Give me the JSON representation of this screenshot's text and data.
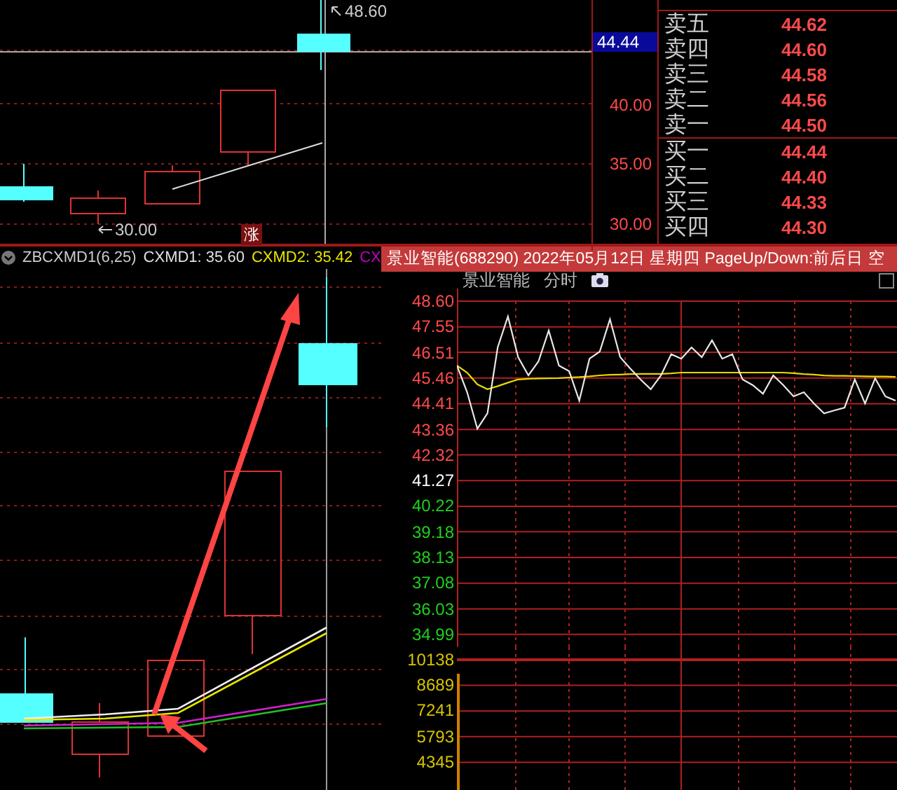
{
  "kline_panel": {
    "high_label": "48.60",
    "low_label": "30.00",
    "badge": "涨",
    "current_price": "44.44",
    "price_labels": [
      {
        "text": "40.00"
      },
      {
        "text": "35.00"
      },
      {
        "text": "30.00"
      }
    ]
  },
  "order_book": {
    "asks": [
      {
        "label": "卖五",
        "price": "44.62"
      },
      {
        "label": "卖四",
        "price": "44.60"
      },
      {
        "label": "卖三",
        "price": "44.58"
      },
      {
        "label": "卖二",
        "price": "44.56"
      },
      {
        "label": "卖一",
        "price": "44.50"
      }
    ],
    "bids": [
      {
        "label": "买一",
        "price": "44.44"
      },
      {
        "label": "买二",
        "price": "44.40"
      },
      {
        "label": "买三",
        "price": "44.33"
      },
      {
        "label": "买四",
        "price": "44.30"
      }
    ]
  },
  "indicator_panel": {
    "name": "ZBCXMD1(6,25)",
    "values": [
      {
        "label": "CXMD1: 35.60",
        "color": "#e0e0e0"
      },
      {
        "label": "CXMD2: 35.42",
        "color": "#e6e600"
      },
      {
        "label": "CX",
        "color": "#c000c0"
      }
    ]
  },
  "intraday_popup": {
    "title": "景业智能(688290) 2022年05月12日 星期四 PageUp/Down:前后日 空",
    "stock": "景业智能",
    "mode": "分时",
    "checkbox": {
      "checked": false
    },
    "volume_labels": [
      {
        "text": "10138",
        "kind": "volume"
      },
      {
        "text": "8689",
        "kind": "volume"
      },
      {
        "text": "7241",
        "kind": "volume"
      },
      {
        "text": "5793",
        "kind": "volume"
      },
      {
        "text": "4345",
        "kind": "volume"
      }
    ],
    "chart_data": {
      "type": "line",
      "ylim": [
        34.99,
        48.6
      ],
      "grid": true,
      "yticks": [
        {
          "value": 48.6,
          "label": "48.60"
        },
        {
          "value": 47.55,
          "label": "47.55"
        },
        {
          "value": 46.51,
          "label": "46.51"
        },
        {
          "value": 45.46,
          "label": "45.46"
        },
        {
          "value": 44.41,
          "label": "44.41"
        },
        {
          "value": 43.36,
          "label": "43.36"
        },
        {
          "value": 42.32,
          "label": "42.32"
        },
        {
          "value": 41.27,
          "label": "41.27"
        },
        {
          "value": 40.22,
          "label": "40.22"
        },
        {
          "value": 39.18,
          "label": "39.18"
        },
        {
          "value": 38.13,
          "label": "38.13"
        },
        {
          "value": 37.08,
          "label": "37.08"
        },
        {
          "value": 36.03,
          "label": "36.03"
        },
        {
          "value": 34.99,
          "label": "34.99"
        }
      ],
      "categories": [
        null,
        null,
        null,
        null,
        null,
        null,
        null,
        null,
        null,
        null,
        null,
        null,
        null,
        null,
        null,
        null,
        null,
        null,
        null,
        null,
        null,
        null,
        null,
        null,
        null,
        null,
        null,
        null,
        null,
        null,
        null,
        null,
        null,
        null,
        null,
        null,
        null,
        null,
        null,
        null,
        null,
        null,
        null,
        null
      ],
      "series": [
        {
          "color": "#e8e8e8",
          "values": [
            45.97,
            44.88,
            43.39,
            44.02,
            46.71,
            47.97,
            46.31,
            45.57,
            46.14,
            47.4,
            45.97,
            45.74,
            44.54,
            46.25,
            46.54,
            47.86,
            46.31,
            45.85,
            45.4,
            45.0,
            45.57,
            46.43,
            46.25,
            46.71,
            46.31,
            47.0,
            46.25,
            46.43,
            45.4,
            45.17,
            44.82,
            45.57,
            45.17,
            44.71,
            44.88,
            44.42,
            44.02,
            44.14,
            44.25,
            45.4,
            44.42,
            45.45,
            44.71,
            44.54
          ]
        },
        {
          "color": "#e6d800",
          "values": [
            45.97,
            45.68,
            45.2,
            45.0,
            45.13,
            45.27,
            45.4,
            45.43,
            45.44,
            45.45,
            45.46,
            45.48,
            45.5,
            45.53,
            45.57,
            45.59,
            45.6,
            45.62,
            45.63,
            45.63,
            45.63,
            45.65,
            45.68,
            45.68,
            45.68,
            45.68,
            45.68,
            45.68,
            45.68,
            45.68,
            45.68,
            45.68,
            45.68,
            45.66,
            45.62,
            45.6,
            45.56,
            45.55,
            45.55,
            45.54,
            45.53,
            45.52,
            45.52,
            45.51
          ]
        }
      ]
    }
  }
}
